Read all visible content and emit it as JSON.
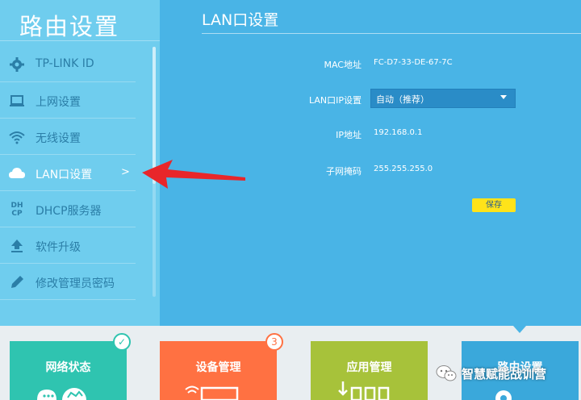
{
  "sidebar": {
    "title": "路由设置",
    "items": [
      {
        "label": "TP-LINK ID",
        "icon": "gear-icon"
      },
      {
        "label": "上网设置",
        "icon": "laptop-icon"
      },
      {
        "label": "无线设置",
        "icon": "wifi-icon"
      },
      {
        "label": "LAN口设置",
        "icon": "cloud-icon",
        "active": true,
        "chevron": ">"
      },
      {
        "label": "DHCP服务器",
        "icon": "dhcp-icon",
        "icon_text": "DH CP"
      },
      {
        "label": "软件升级",
        "icon": "upload-icon"
      },
      {
        "label": "修改管理员密码",
        "icon": "pencil-icon"
      }
    ]
  },
  "main": {
    "title": "LAN口设置",
    "mac_label": "MAC地址",
    "mac_value": "FC-D7-33-DE-67-7C",
    "lan_ip_label": "LAN口IP设置",
    "lan_ip_selected": "自动（推荐）",
    "ip_label": "IP地址",
    "ip_value": "192.168.0.1",
    "mask_label": "子网掩码",
    "mask_value": "255.255.255.0",
    "save_label": "保存"
  },
  "tiles": {
    "network_status": "网络状态",
    "device_mgmt": "设备管理",
    "device_count": "3",
    "app_mgmt": "应用管理",
    "router_settings": "路由设置"
  },
  "watermark": {
    "text": "智慧赋能战训营"
  },
  "colors": {
    "sidebar_bg": "#6fcdee",
    "main_bg": "#49b4e6",
    "accent_yellow": "#ffe31a",
    "tile_teal": "#2fc4b0",
    "tile_orange": "#ff7142",
    "tile_green": "#a7c23a",
    "tile_blue": "#3aa8db",
    "arrow_red": "#e8262a"
  }
}
